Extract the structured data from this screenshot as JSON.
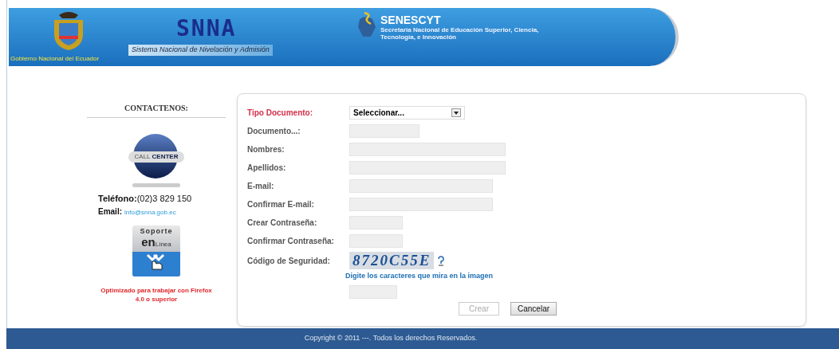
{
  "header": {
    "government": "Gobierno Nacional del Ecuador",
    "title": "SNNA",
    "subtitle": "Sistema Nacional de Nivelación y Admisión",
    "agency": "SENESCYT",
    "agency_subtitle": "Secretaría Nacional de Educación Superior, Ciencia, Tecnología, e Innovación"
  },
  "contact": {
    "heading": "CONTACTENOS:",
    "call_center": [
      "CALL",
      "CENTER"
    ],
    "phone": "**Teléfono:**(02)3 829 150",
    "email_label": "Email:",
    "email": "info@snna.gob.ec",
    "support": [
      "Soporte",
      "en",
      "Línea"
    ],
    "note": "Optimizado para trabajar con Firefox 4.0 o superior"
  },
  "form": {
    "fields": [
      {
        "label": "Tipo Documento:",
        "kind": "select",
        "highlighted": true,
        "value": "Seleccionar..."
      },
      {
        "label": "Documento...:",
        "kind": "text",
        "highlighted": false
      },
      {
        "label": "Nombres:",
        "kind": "text",
        "highlighted": false
      },
      {
        "label": "Apellidos:",
        "kind": "text",
        "highlighted": false
      },
      {
        "label": "E-mail:",
        "kind": "text",
        "highlighted": false
      },
      {
        "label": "Confirmar E-mail:",
        "kind": "text",
        "highlighted": false
      },
      {
        "label": "Crear Contraseña:",
        "kind": "text",
        "highlighted": false
      },
      {
        "label": "Confirmar Contraseña:",
        "kind": "text",
        "highlighted": false
      },
      {
        "label": "Código de Seguridad:",
        "kind": "captcha",
        "highlighted": false,
        "code": "8720C55E",
        "hint": "Digite los caracteres que mira en la imagen"
      }
    ],
    "buttons": [
      {
        "label": "Crear",
        "disabled": true
      },
      {
        "label": "Cancelar",
        "disabled": false
      }
    ]
  },
  "footer": "Copyright © 2011 ---. Todos los derechos Reservados."
}
